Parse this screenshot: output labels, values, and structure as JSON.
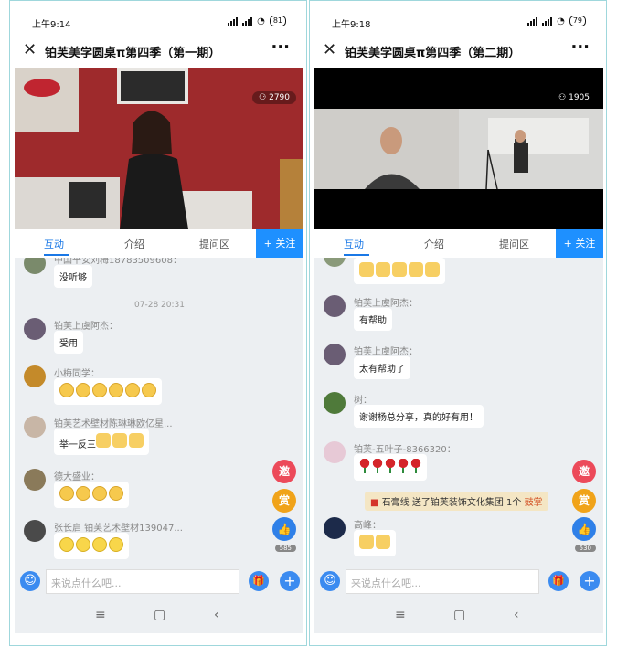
{
  "panels": [
    {
      "status": {
        "time": "上午9:14",
        "battery": "81"
      },
      "title": "铂芙美学圆桌π第四季（第一期）",
      "viewers": "2790",
      "tabs": [
        "互动",
        "介绍",
        "提问区"
      ],
      "follow_label": "+ 关注",
      "top_partial_name": "中国平安刘梅18783509608：",
      "top_partial_text": "没听够",
      "timestamp": "07-28 20:31",
      "messages": [
        {
          "name": "铂芙上虞阿杰：",
          "text": "受用",
          "emoji": "",
          "count": 0
        },
        {
          "name": "小梅同学：",
          "text": "",
          "emoji": "pray",
          "count": 6
        },
        {
          "name": "铂芙艺术壁材陈琳琳欧亿星...",
          "text": "举一反三",
          "emoji": "thumb",
          "count": 3
        },
        {
          "name": "德大盛业：",
          "text": "",
          "emoji": "pray",
          "count": 4
        },
        {
          "name": "张长启 铂芙艺术壁材139047...",
          "text": "",
          "emoji": "smile",
          "count": 4
        }
      ],
      "side_buttons": [
        "邀",
        "赏"
      ],
      "like_count": "585",
      "input_placeholder": "来说点什么吧..."
    },
    {
      "status": {
        "time": "上午9:18",
        "battery": "79"
      },
      "title": "铂芙美学圆桌π第四季（第二期）",
      "viewers": "1905",
      "tabs": [
        "互动",
        "介绍",
        "提问区"
      ],
      "follow_label": "+ 关注",
      "top_partial_emoji_count": 5,
      "messages": [
        {
          "name": "铂芙上虞阿杰：",
          "text": "有帮助",
          "emoji": "",
          "count": 0
        },
        {
          "name": "铂芙上虞阿杰：",
          "text": "太有帮助了",
          "emoji": "",
          "count": 0
        },
        {
          "name": "树：",
          "text": "谢谢杨总分享，真的好有用！",
          "emoji": "",
          "count": 0
        },
        {
          "name": "铂芙-五叶子-8366320：",
          "text": "",
          "emoji": "rose",
          "count": 5
        },
        {
          "name": "高峰：",
          "text": "",
          "emoji": "thumb",
          "count": 2
        }
      ],
      "gift_banner": {
        "prefix": "石膏线 送了铂芙装饰文化集团 1个",
        "item": "鼓掌"
      },
      "side_buttons": [
        "邀",
        "赏"
      ],
      "like_count": "530",
      "input_placeholder": "来说点什么吧..."
    }
  ],
  "colors": {
    "accent": "#1e90ff",
    "chat_bg": "#eceff2",
    "invite": "#ec4a5a",
    "reward": "#f0a31a"
  }
}
